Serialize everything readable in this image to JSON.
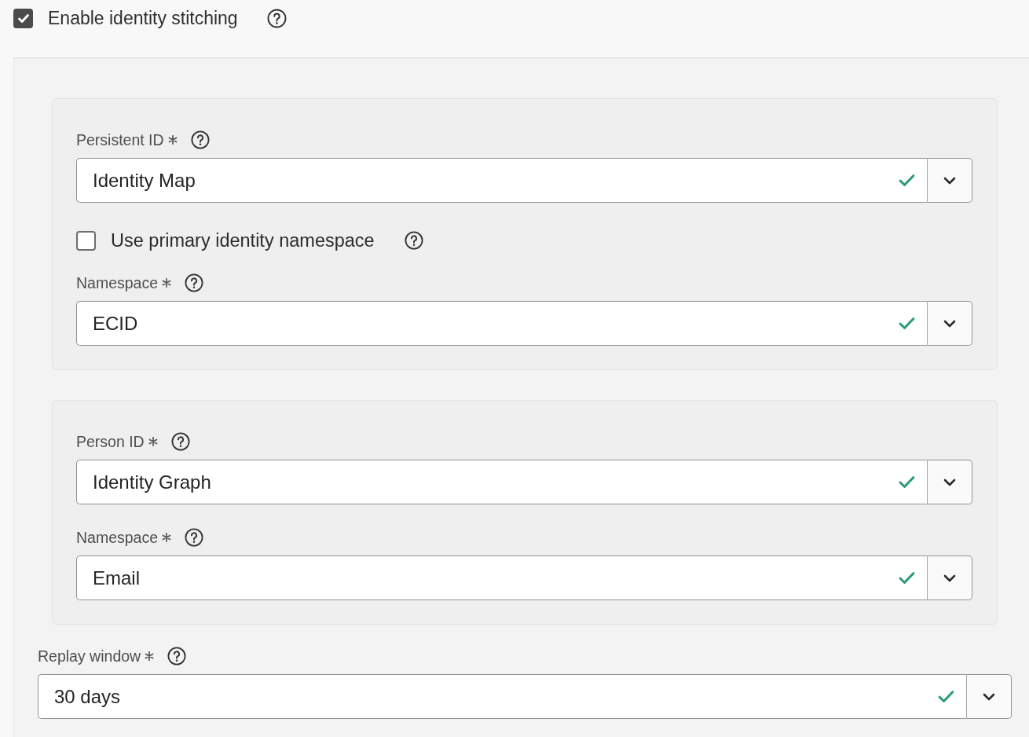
{
  "identity_stitching": {
    "label": "Enable identity stitching",
    "checked": true,
    "help": true
  },
  "groups": [
    {
      "fields": [
        {
          "kind": "select",
          "label": "Persistent ID",
          "required": true,
          "help": true,
          "value": "Identity Map",
          "valid": true
        },
        {
          "kind": "checkbox",
          "label": "Use primary identity namespace",
          "checked": false,
          "help": true
        },
        {
          "kind": "select",
          "label": "Namespace",
          "required": true,
          "help": true,
          "value": "ECID",
          "valid": true
        }
      ]
    },
    {
      "fields": [
        {
          "kind": "select",
          "label": "Person ID",
          "required": true,
          "help": true,
          "value": "Identity Graph",
          "valid": true
        },
        {
          "kind": "select",
          "label": "Namespace",
          "required": true,
          "help": true,
          "value": "Email",
          "valid": true
        }
      ]
    }
  ],
  "replay_window": {
    "kind": "select",
    "label": "Replay window",
    "required": true,
    "help": true,
    "value": "30 days",
    "valid": true
  }
}
